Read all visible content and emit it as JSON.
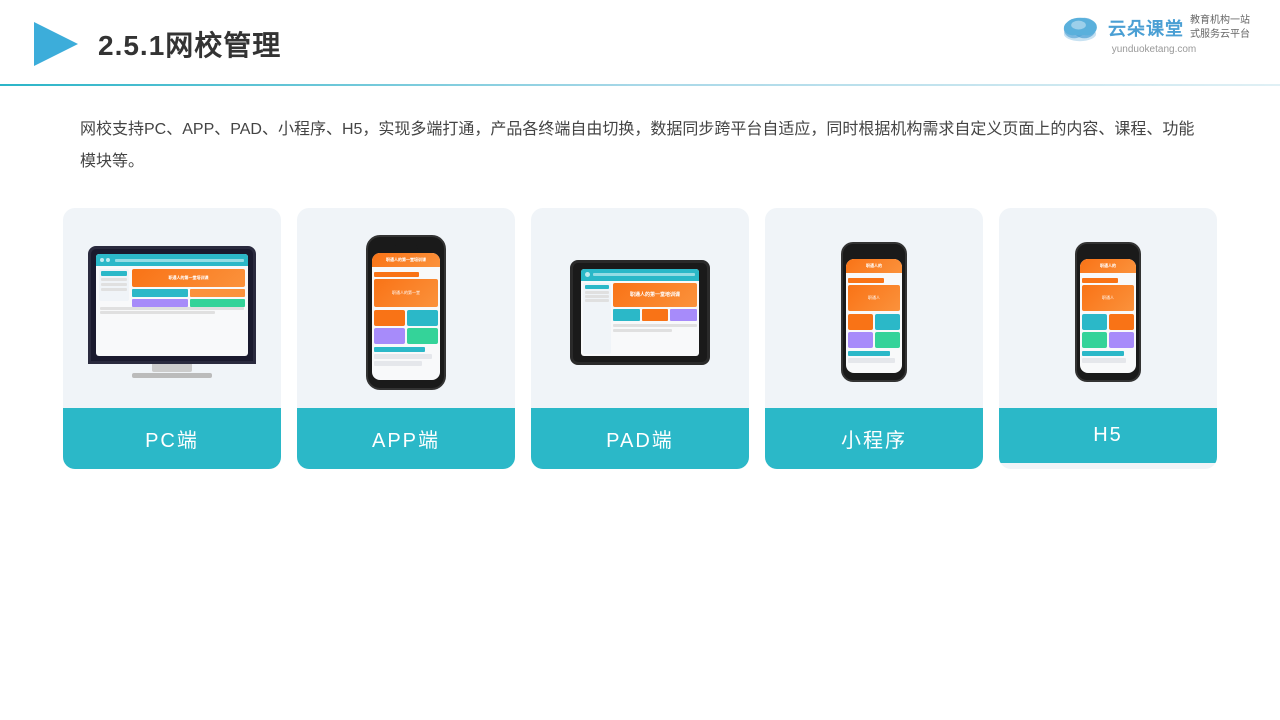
{
  "header": {
    "title": "2.5.1网校管理",
    "brand_name": "云朵课堂",
    "brand_url": "yunduoketang.com",
    "brand_slogan": "教育机构一站\n式服务云平台"
  },
  "description": {
    "text": "网校支持PC、APP、PAD、小程序、H5，实现多端打通，产品各终端自由切换，数据同步跨平台自适应，同时根据机构需求自定义页面上的内容、课程、功能模块等。"
  },
  "cards": [
    {
      "id": "pc",
      "label": "PC端"
    },
    {
      "id": "app",
      "label": "APP端"
    },
    {
      "id": "pad",
      "label": "PAD端"
    },
    {
      "id": "miniprogram",
      "label": "小程序"
    },
    {
      "id": "h5",
      "label": "H5"
    }
  ],
  "colors": {
    "teal": "#2bb8c8",
    "accent_orange": "#f97316",
    "bg_card": "#f0f4f8",
    "divider_start": "#2bb5c8",
    "divider_end": "#e0f0f5"
  }
}
